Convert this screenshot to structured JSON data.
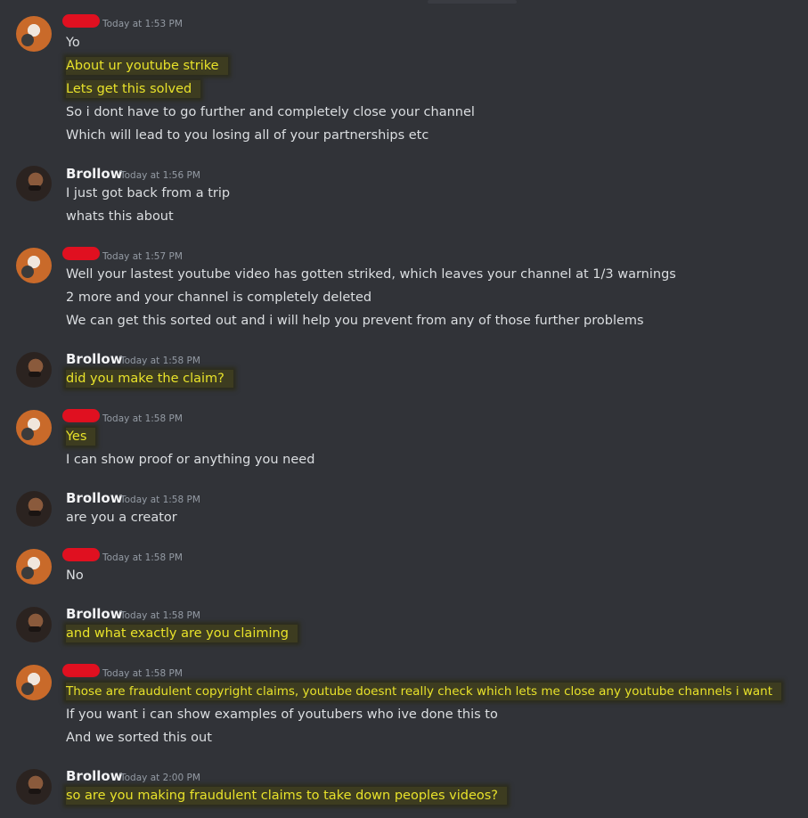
{
  "messages": [
    {
      "author": "",
      "redacted": true,
      "timestamp": "Today at 1:53 PM",
      "lines": [
        {
          "text": "Yo",
          "highlight": false
        },
        {
          "text": "About ur youtube strike",
          "highlight": true
        },
        {
          "text": "Lets get this solved",
          "highlight": true
        },
        {
          "text": "So i dont have to go further and completely close your channel",
          "highlight": false
        },
        {
          "text": "Which will lead to you losing all of your partnerships etc",
          "highlight": false
        }
      ]
    },
    {
      "author": "Brollow",
      "redacted": false,
      "timestamp": "Today at 1:56 PM",
      "lines": [
        {
          "text": "I just got back from a trip",
          "highlight": false
        },
        {
          "text": "whats this about",
          "highlight": false
        }
      ]
    },
    {
      "author": "",
      "redacted": true,
      "timestamp": "Today at 1:57 PM",
      "lines": [
        {
          "text": "Well your lastest youtube video has gotten striked, which leaves your channel at 1/3 warnings",
          "highlight": false
        },
        {
          "text": "2 more and your channel is completely deleted",
          "highlight": false
        },
        {
          "text": "We can get this sorted out and i will help you prevent from any of those further problems",
          "highlight": false
        }
      ]
    },
    {
      "author": "Brollow",
      "redacted": false,
      "timestamp": "Today at 1:58 PM",
      "lines": [
        {
          "text": "did you make the claim?",
          "highlight": true
        }
      ]
    },
    {
      "author": "",
      "redacted": true,
      "timestamp": "Today at 1:58 PM",
      "lines": [
        {
          "text": "Yes",
          "highlight": true
        },
        {
          "text": "I can show proof or anything you need",
          "highlight": false
        }
      ]
    },
    {
      "author": "Brollow",
      "redacted": false,
      "timestamp": "Today at 1:58 PM",
      "lines": [
        {
          "text": "are you a creator",
          "highlight": false
        }
      ]
    },
    {
      "author": "",
      "redacted": true,
      "timestamp": "Today at 1:58 PM",
      "lines": [
        {
          "text": "No",
          "highlight": false
        }
      ]
    },
    {
      "author": "Brollow",
      "redacted": false,
      "timestamp": "Today at 1:58 PM",
      "lines": [
        {
          "text": "and what exactly are you claiming",
          "highlight": true
        }
      ]
    },
    {
      "author": "",
      "redacted": true,
      "timestamp": "Today at 1:58 PM",
      "lines": [
        {
          "text": "Those are fraudulent copyright claims, youtube doesnt really check which lets me close any youtube channels i want",
          "highlight": true
        },
        {
          "text": "If you want i can show examples of youtubers who ive done this to",
          "highlight": false
        },
        {
          "text": "And we sorted this out",
          "highlight": false
        }
      ]
    },
    {
      "author": "Brollow",
      "redacted": false,
      "timestamp": "Today at 2:00 PM",
      "lines": [
        {
          "text": "so are you making fraudulent claims to take down peoples videos?",
          "highlight": true
        }
      ]
    }
  ]
}
